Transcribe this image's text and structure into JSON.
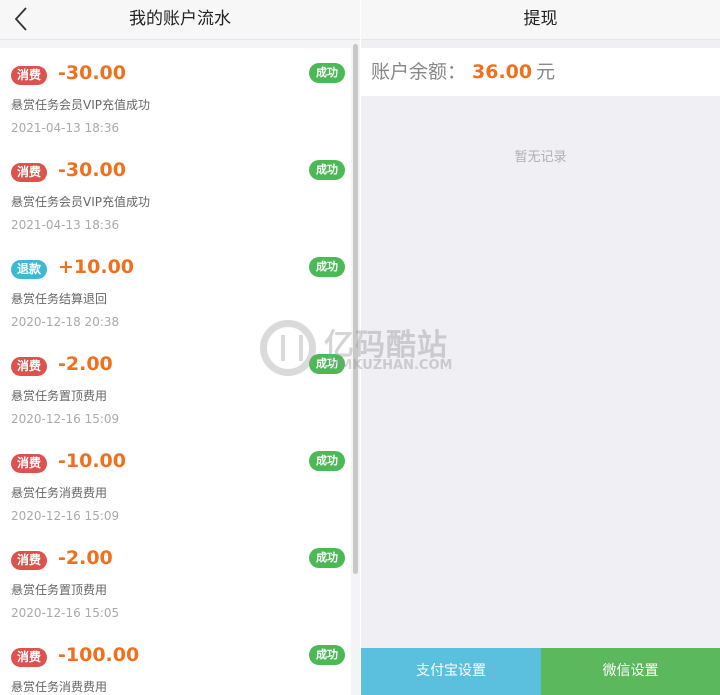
{
  "left": {
    "title": "我的账户流水",
    "transactions": [
      {
        "type": "消费",
        "amount": "-30.00",
        "desc": "悬赏任务会员VIP充值成功",
        "time": "2021-04-13 18:36",
        "status": "成功"
      },
      {
        "type": "消费",
        "amount": "-30.00",
        "desc": "悬赏任务会员VIP充值成功",
        "time": "2021-04-13 18:36",
        "status": "成功"
      },
      {
        "type": "退款",
        "amount": "+10.00",
        "desc": "悬赏任务结算退回",
        "time": "2020-12-18 20:38",
        "status": "成功"
      },
      {
        "type": "消费",
        "amount": "-2.00",
        "desc": "悬赏任务置顶费用",
        "time": "2020-12-16 15:09",
        "status": "成功"
      },
      {
        "type": "消费",
        "amount": "-10.00",
        "desc": "悬赏任务消费费用",
        "time": "2020-12-16 15:09",
        "status": "成功"
      },
      {
        "type": "消费",
        "amount": "-2.00",
        "desc": "悬赏任务置顶费用",
        "time": "2020-12-16 15:05",
        "status": "成功"
      },
      {
        "type": "消费",
        "amount": "-100.00",
        "desc": "悬赏任务消费费用",
        "time": "",
        "status": "成功"
      }
    ]
  },
  "right": {
    "title": "提现",
    "balance_label": "账户余额：",
    "balance_value": "36.00",
    "balance_unit": "元",
    "empty_text": "暂无记录",
    "alipay_button": "支付宝设置",
    "wechat_button": "微信设置"
  },
  "watermark": {
    "text": "亿码酷站",
    "sub": "YMKUZHAN.COM"
  },
  "colors": {
    "amount": "#f0701d",
    "consume_badge": "#dd524d",
    "refund_badge": "#3fb8d6",
    "success_badge": "#4cb957",
    "alipay": "#5bc0de",
    "wechat": "#5cb85c"
  }
}
